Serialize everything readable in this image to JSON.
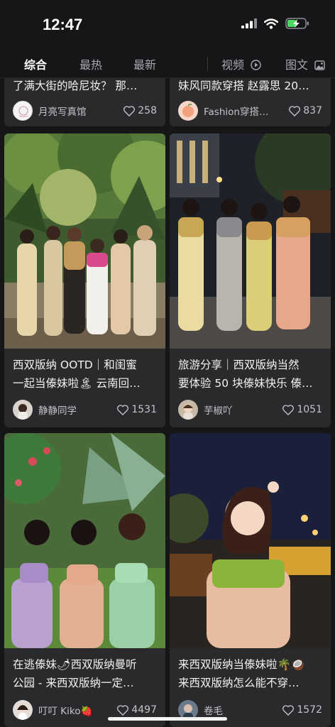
{
  "status": {
    "time": "12:47"
  },
  "tabs": {
    "all": "综合",
    "hot": "最热",
    "latest": "最新",
    "video": "视频",
    "imagetext": "图文"
  },
  "cards": [
    {
      "title": "了满大街的哈尼妆？ 那…",
      "author": "月亮写真馆",
      "likes": "258"
    },
    {
      "title": "妹风同款穿搭 赵露思 20…",
      "author": "Fashion穿搭…",
      "likes": "837"
    },
    {
      "title_line1": "西双版纳 OOTD｜和闺蜜",
      "title_line2": "一起当傣妹啦🏝 云南回…",
      "author": "静静同学",
      "likes": "1531"
    },
    {
      "title_line1": "旅游分享｜西双版纳当然",
      "title_line2": "要体验 50 块傣妹快乐 傣…",
      "author": "芋椒吖",
      "likes": "1051"
    },
    {
      "title_line1": "在逃傣妹🌶西双版纳曼听",
      "title_line2": "公园 - 来西双版纳一定…",
      "author": "叮叮 Kiko🍓",
      "likes": "4497"
    },
    {
      "title_line1": "来西双版纳当傣妹啦🌴🥥",
      "title_line2": "来西双版纳怎么能不穿…",
      "author": "卷毛",
      "likes": "1572"
    }
  ]
}
